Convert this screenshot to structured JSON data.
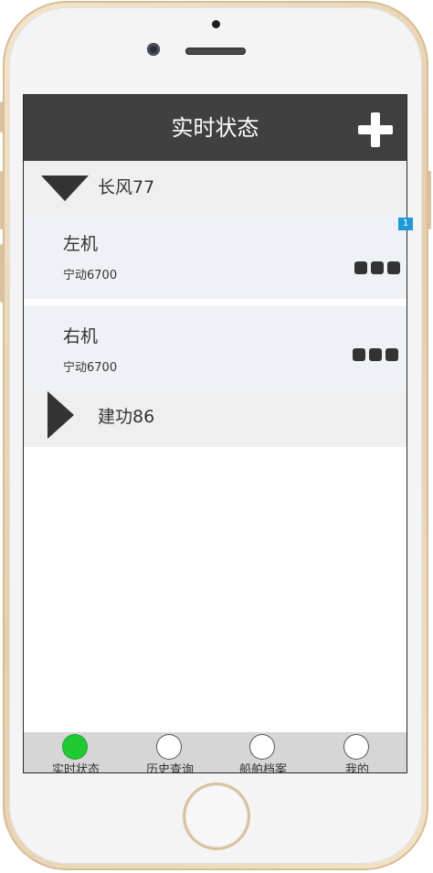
{
  "header": {
    "title": "实时状态",
    "add_icon": "plus-icon"
  },
  "groups": [
    {
      "name": "长风77",
      "expanded": true,
      "icon": "triangle-down-icon",
      "engines": [
        {
          "name": "左机",
          "model": "宁动6700",
          "badge": "1",
          "menu_icon": "more-icon"
        },
        {
          "name": "右机",
          "model": "宁动6700",
          "menu_icon": "more-icon"
        }
      ]
    },
    {
      "name": "建功86",
      "expanded": false,
      "icon": "triangle-right-icon"
    }
  ],
  "tabs": [
    {
      "label": "实时状态",
      "active": true
    },
    {
      "label": "历史查询",
      "active": false
    },
    {
      "label": "船舶档案",
      "active": false
    },
    {
      "label": "我的",
      "active": false
    }
  ],
  "colors": {
    "header_bg": "#404040",
    "active_tab": "#1ecb35",
    "badge": "#1e9ad6"
  }
}
